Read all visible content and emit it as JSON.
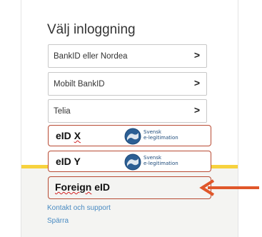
{
  "title": "Välj inloggning",
  "options": [
    {
      "label": "BankID eller Nordea",
      "chevron": ">"
    },
    {
      "label": "Mobilt BankID",
      "chevron": ">"
    },
    {
      "label": "Telia",
      "chevron": ">"
    }
  ],
  "eid_options": [
    {
      "label_main": "eID",
      "label_suffix": "X",
      "logo_text_1": "Svensk",
      "logo_text_2": "e-legitimation"
    },
    {
      "label_main": "eID",
      "label_suffix": "Y",
      "logo_text_1": "Svensk",
      "logo_text_2": "e-legitimation"
    }
  ],
  "foreign": {
    "label_main": "Foreign",
    "label_suffix": "eID"
  },
  "links": {
    "contact": "Kontakt och support",
    "block": "Spärra"
  },
  "colors": {
    "highlight_border": "#b84a33",
    "arrow": "#e0572a",
    "link": "#4a8bc2",
    "yellow": "#f7d23e"
  },
  "icons": {
    "chevron": "chevron-right-icon",
    "logo": "svensk-e-legitimation-logo",
    "arrow": "arrow-left-icon"
  }
}
